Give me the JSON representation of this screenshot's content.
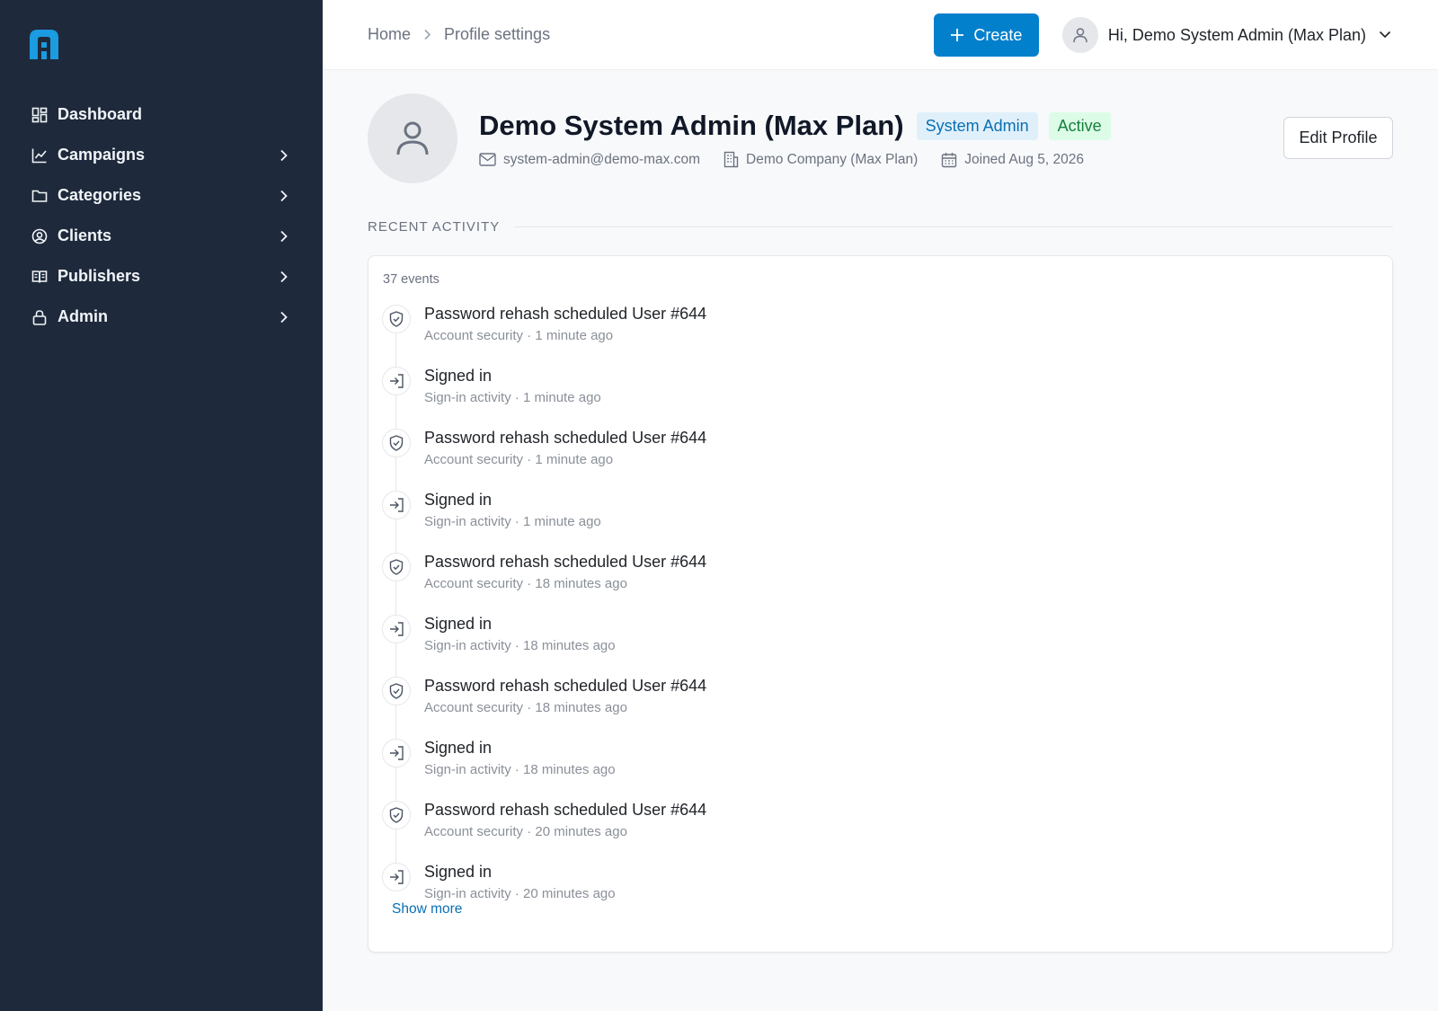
{
  "colors": {
    "sidebar_bg": "#1e293b",
    "accent": "#0280cc",
    "logo": "#1b9be0"
  },
  "sidebar": {
    "logo_icon": "brand-logo",
    "items": [
      {
        "label": "Dashboard",
        "icon": "dashboard-icon",
        "has_children": false
      },
      {
        "label": "Campaigns",
        "icon": "chart-line-icon",
        "has_children": true
      },
      {
        "label": "Categories",
        "icon": "folder-icon",
        "has_children": true
      },
      {
        "label": "Clients",
        "icon": "user-circle-icon",
        "has_children": true
      },
      {
        "label": "Publishers",
        "icon": "book-open-icon",
        "has_children": true
      },
      {
        "label": "Admin",
        "icon": "lock-icon",
        "has_children": true
      }
    ]
  },
  "header": {
    "breadcrumb": [
      "Home",
      "Profile settings"
    ],
    "create_label": "Create",
    "greeting": "Hi, Demo System Admin (Max Plan)"
  },
  "profile": {
    "name": "Demo System Admin (Max Plan)",
    "role_badge": "System Admin",
    "status_badge": "Active",
    "email": "system-admin@demo-max.com",
    "company": "Demo Company (Max Plan)",
    "joined": "Joined Aug 5, 2026",
    "edit_label": "Edit Profile"
  },
  "activity": {
    "section_title": "RECENT ACTIVITY",
    "count_label": "37 events",
    "show_more_label": "Show more",
    "events": [
      {
        "title": "Password rehash scheduled User #644",
        "subtitle": "Account security · 1 minute ago",
        "icon": "shield-check-icon"
      },
      {
        "title": "Signed in",
        "subtitle": "Sign-in activity · 1 minute ago",
        "icon": "sign-in-icon"
      },
      {
        "title": "Password rehash scheduled User #644",
        "subtitle": "Account security · 1 minute ago",
        "icon": "shield-check-icon"
      },
      {
        "title": "Signed in",
        "subtitle": "Sign-in activity · 1 minute ago",
        "icon": "sign-in-icon"
      },
      {
        "title": "Password rehash scheduled User #644",
        "subtitle": "Account security · 18 minutes ago",
        "icon": "shield-check-icon"
      },
      {
        "title": "Signed in",
        "subtitle": "Sign-in activity · 18 minutes ago",
        "icon": "sign-in-icon"
      },
      {
        "title": "Password rehash scheduled User #644",
        "subtitle": "Account security · 18 minutes ago",
        "icon": "shield-check-icon"
      },
      {
        "title": "Signed in",
        "subtitle": "Sign-in activity · 18 minutes ago",
        "icon": "sign-in-icon"
      },
      {
        "title": "Password rehash scheduled User #644",
        "subtitle": "Account security · 20 minutes ago",
        "icon": "shield-check-icon"
      },
      {
        "title": "Signed in",
        "subtitle": "Sign-in activity · 20 minutes ago",
        "icon": "sign-in-icon"
      }
    ]
  }
}
